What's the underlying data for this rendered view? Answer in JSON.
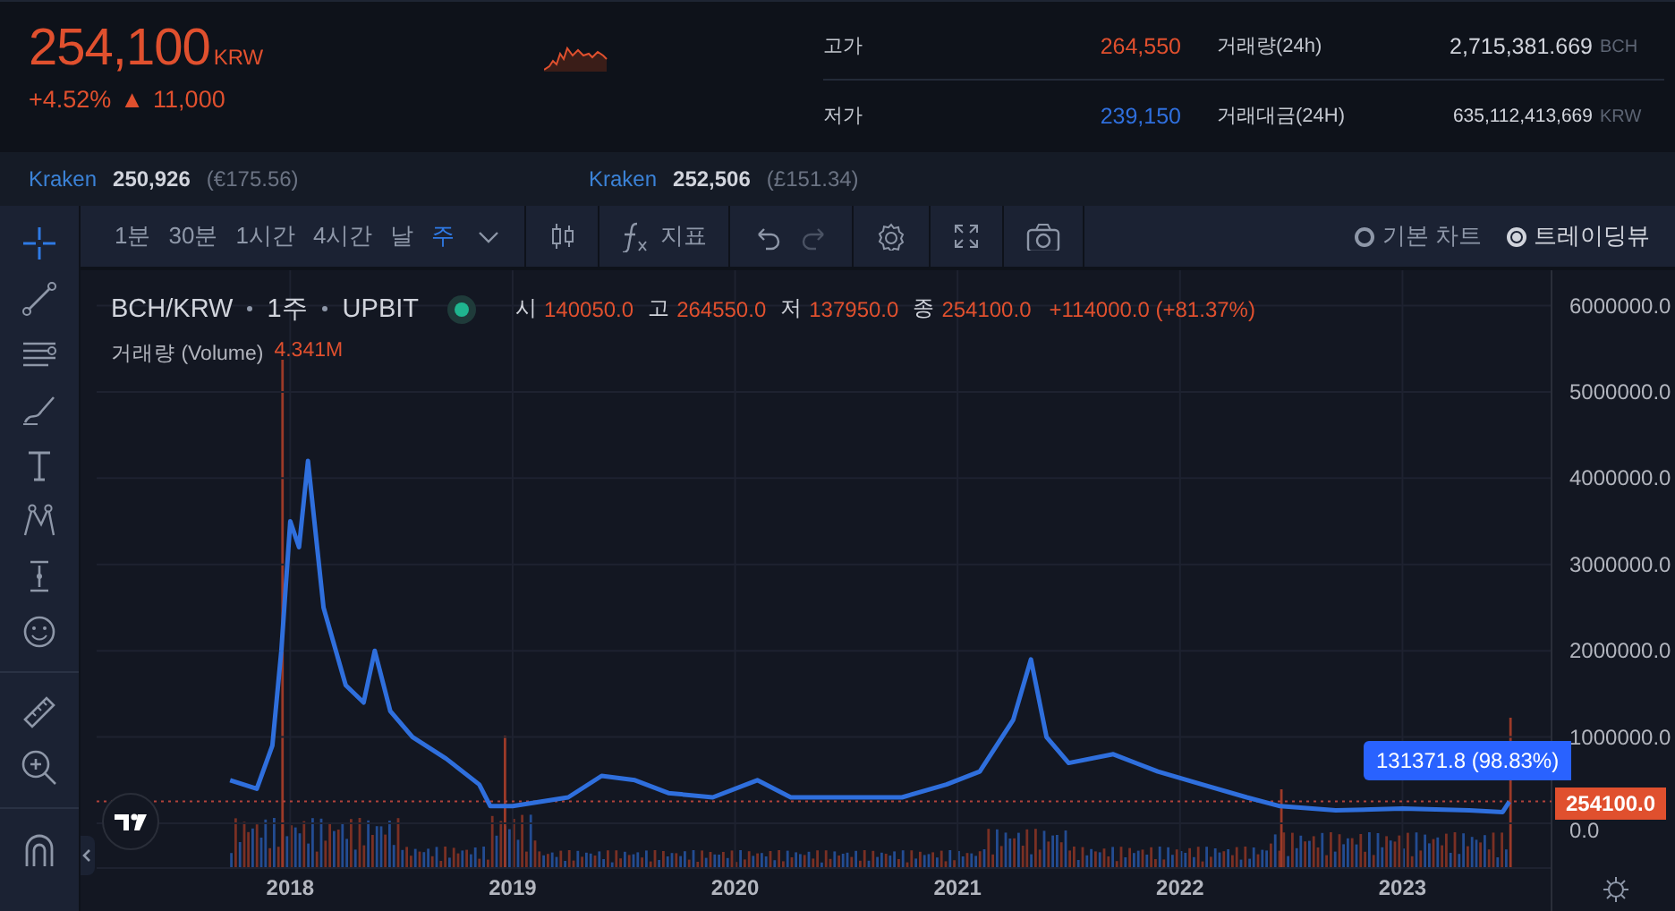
{
  "ticker": {
    "price": "254,100",
    "currency": "KRW",
    "change_pct": "+4.52%",
    "change_arrow": "▲",
    "change_abs": "11,000"
  },
  "stats": [
    {
      "label": "고가",
      "value": "264,550",
      "kind": "up"
    },
    {
      "label": "거래량(24h)",
      "value": "2,715,381.669",
      "unit": "BCH",
      "kind": "plain"
    },
    {
      "label": "저가",
      "value": "239,150",
      "kind": "down"
    },
    {
      "label": "거래대금(24H)",
      "value": "635,112,413,669",
      "unit": "KRW",
      "kind": "plain"
    }
  ],
  "exchanges": [
    {
      "name": "Kraken",
      "price": "250,926",
      "fiat": "(€175.56)"
    },
    {
      "name": "Kraken",
      "price": "252,506",
      "fiat": "(£151.34)"
    }
  ],
  "intervals": [
    {
      "label": "1분",
      "selected": false
    },
    {
      "label": "30분",
      "selected": false
    },
    {
      "label": "1시간",
      "selected": false
    },
    {
      "label": "4시간",
      "selected": false
    },
    {
      "label": "날",
      "selected": false
    },
    {
      "label": "주",
      "selected": true
    }
  ],
  "toolbar": {
    "indicator_label": "지표"
  },
  "chart_modes": [
    {
      "label": "기본 차트",
      "selected": false
    },
    {
      "label": "트레이딩뷰",
      "selected": true
    }
  ],
  "tools": [
    {
      "kind": "crosshair",
      "selected": true
    },
    {
      "kind": "trendline",
      "selected": false
    },
    {
      "kind": "lines",
      "selected": false
    },
    {
      "kind": "brush",
      "selected": false
    },
    {
      "kind": "text",
      "selected": false
    },
    {
      "kind": "pattern",
      "selected": false
    },
    {
      "kind": "measure",
      "selected": false
    },
    {
      "kind": "emoji",
      "selected": false
    },
    {
      "kind": "ruler",
      "selected": false
    },
    {
      "kind": "zoom",
      "selected": false
    },
    {
      "kind": "magnet",
      "selected": false
    }
  ],
  "legend": {
    "symbol": "BCH/KRW",
    "interval": "1주",
    "exchange": "UPBIT",
    "ohlc": [
      {
        "key": "시",
        "value": "140050.0"
      },
      {
        "key": "고",
        "value": "264550.0"
      },
      {
        "key": "저",
        "value": "137950.0"
      },
      {
        "key": "종",
        "value": "254100.0"
      }
    ],
    "change": "+114000.0 (+81.37%)",
    "volume_label": "거래량 (Volume)",
    "volume_value": "4.341M"
  },
  "price_badge": "254100.0",
  "crosshair_badge": "131371.8 (98.83%)",
  "chart_data": {
    "type": "line",
    "x": [
      2017.73,
      2017.85,
      2017.92,
      2017.96,
      2018.0,
      2018.04,
      2018.08,
      2018.15,
      2018.25,
      2018.33,
      2018.38,
      2018.45,
      2018.55,
      2018.7,
      2018.85,
      2018.9,
      2019.0,
      2019.25,
      2019.4,
      2019.55,
      2019.7,
      2019.9,
      2020.1,
      2020.25,
      2020.5,
      2020.75,
      2020.95,
      2021.1,
      2021.25,
      2021.33,
      2021.4,
      2021.5,
      2021.7,
      2021.9,
      2022.1,
      2022.3,
      2022.45,
      2022.7,
      2023.0,
      2023.3,
      2023.45,
      2023.48
    ],
    "series": [
      {
        "color": "#2f6fdd",
        "values": [
          500000,
          400000,
          900000,
          2000000,
          3500000,
          3200000,
          4200000,
          2500000,
          1600000,
          1400000,
          2000000,
          1300000,
          1000000,
          750000,
          450000,
          200000,
          200000,
          300000,
          550000,
          500000,
          350000,
          300000,
          500000,
          300000,
          300000,
          300000,
          450000,
          600000,
          1200000,
          1900000,
          1000000,
          700000,
          800000,
          600000,
          450000,
          300000,
          200000,
          150000,
          170000,
          150000,
          130000,
          250000
        ]
      }
    ],
    "xlim": [
      2017.13,
      2023.67
    ],
    "ylim": [
      0,
      6410000
    ],
    "grid": true,
    "ref_lines": [
      {
        "axis": "y",
        "value": 254100
      }
    ],
    "xticks": [
      {
        "value": 2018,
        "label": "2018"
      },
      {
        "value": 2019,
        "label": "2019"
      },
      {
        "value": 2020,
        "label": "2020"
      },
      {
        "value": 2021,
        "label": "2021"
      },
      {
        "value": 2022,
        "label": "2022"
      },
      {
        "value": 2023,
        "label": "2023"
      }
    ],
    "yticks": [
      {
        "value": 0,
        "label": "0.0"
      },
      {
        "value": 1000000,
        "label": "1000000.0"
      },
      {
        "value": 2000000,
        "label": "2000000.0"
      },
      {
        "value": 3000000,
        "label": "3000000.0"
      },
      {
        "value": 4000000,
        "label": "4000000.0"
      },
      {
        "value": 5000000,
        "label": "5000000.0"
      },
      {
        "value": 6000000,
        "label": "6000000.0"
      }
    ]
  }
}
